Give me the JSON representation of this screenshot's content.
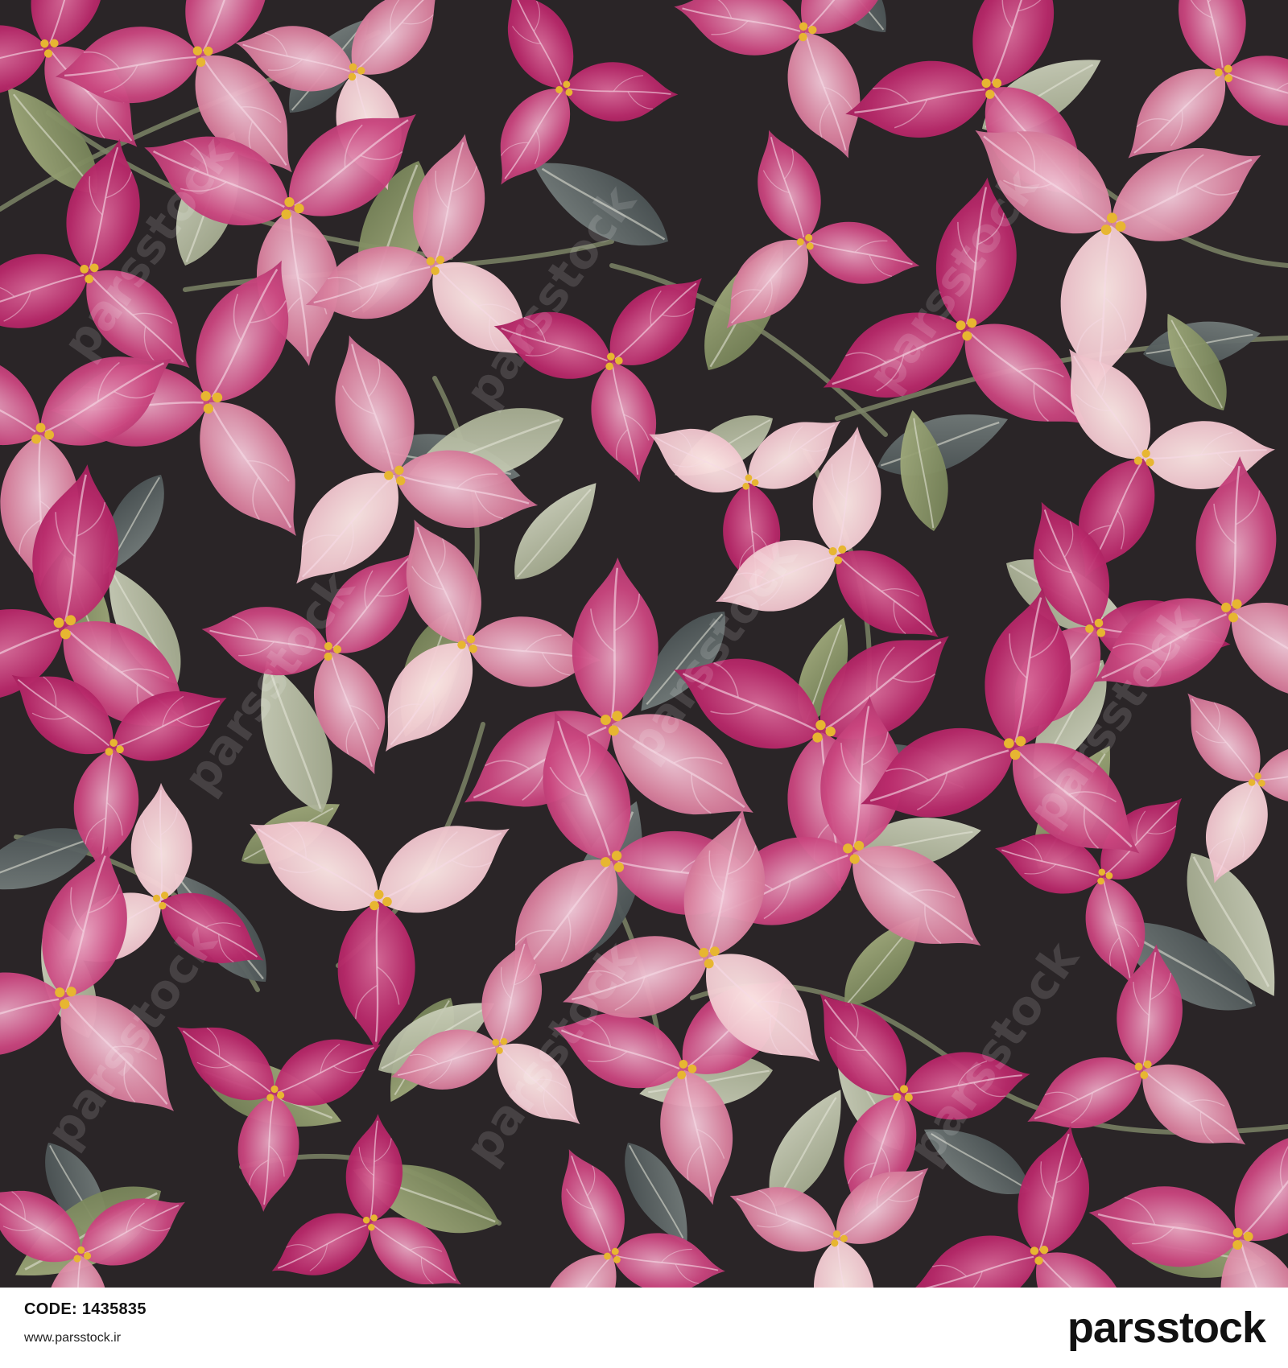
{
  "artwork": {
    "description_colors": {
      "background": "#2a2527",
      "bract_dark": "#b2205f",
      "bract_mid": "#c9457e",
      "bract_light": "#dc86ab",
      "bract_pale": "#efc7cf",
      "leaf_green": "#8d9a6a",
      "leaf_light": "#b7bea0",
      "leaf_gray": "#5d6565",
      "stamen": "#e7b631"
    },
    "watermark_text": "parsstock"
  },
  "footer": {
    "code_label": "CODE:",
    "code_value": "1435835",
    "website": "www.parsstock.ir",
    "brand": "parsstock"
  }
}
